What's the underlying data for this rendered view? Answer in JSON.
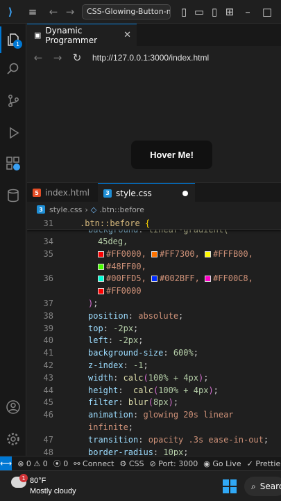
{
  "titlebar": {
    "command_center": "CSS-Glowing-Button-mast"
  },
  "browser": {
    "tab_title": "Dynamic Programmer",
    "url": "http://127.0.0.1:3000/index.html",
    "button_label": "Hover Me!"
  },
  "activity": {
    "explorer_badge": "1"
  },
  "editor": {
    "tabs": [
      {
        "label": "index.html",
        "icon": "html5-file-icon"
      },
      {
        "label": "style.css",
        "icon": "css3-file-icon",
        "dirty": true
      }
    ],
    "breadcrumb": {
      "file": "style.css",
      "symbol": ".btn::before"
    },
    "sticky": {
      "line": "31",
      "selector": ".btn::before",
      "brace": "{"
    },
    "partial_line": {
      "prop": "background",
      "val": "linear-gradient("
    },
    "lines": [
      {
        "n": "34",
        "parts": [
          {
            "t": "45deg,",
            "c": "num"
          }
        ]
      },
      {
        "n": "35",
        "parts": [
          {
            "sw": "#FF0000"
          },
          {
            "t": "#FF0000, ",
            "c": "val"
          },
          {
            "sw": "#FF7300"
          },
          {
            "t": "#FF7300, ",
            "c": "val"
          },
          {
            "sw": "#FFFB00"
          },
          {
            "t": "#FFFB00,",
            "c": "val"
          }
        ]
      },
      {
        "n": "",
        "parts": [
          {
            "sw": "#48FF00"
          },
          {
            "t": "#48FF00,",
            "c": "val"
          }
        ]
      },
      {
        "n": "36",
        "parts": [
          {
            "sw": "#00FFD5"
          },
          {
            "t": "#00FFD5, ",
            "c": "val"
          },
          {
            "sw": "#002BFF"
          },
          {
            "t": "#002BFF, ",
            "c": "val"
          },
          {
            "sw": "#FF00C8"
          },
          {
            "t": "#FF00C8,",
            "c": "val"
          }
        ]
      },
      {
        "n": "",
        "parts": [
          {
            "sw": "#FF0000"
          },
          {
            "t": "#FF0000",
            "c": "val"
          }
        ]
      },
      {
        "n": "37",
        "parts": [
          {
            "t": ")",
            "c": "paren"
          },
          {
            "t": ";",
            "c": "punc"
          }
        ]
      },
      {
        "n": "38",
        "parts": [
          {
            "t": "position",
            "c": "prop"
          },
          {
            "t": ": ",
            "c": "punc"
          },
          {
            "t": "absolute",
            "c": "val"
          },
          {
            "t": ";",
            "c": "punc"
          }
        ]
      },
      {
        "n": "39",
        "parts": [
          {
            "t": "top",
            "c": "prop"
          },
          {
            "t": ": ",
            "c": "punc"
          },
          {
            "t": "-2px",
            "c": "num"
          },
          {
            "t": ";",
            "c": "punc"
          }
        ]
      },
      {
        "n": "40",
        "parts": [
          {
            "t": "left",
            "c": "prop"
          },
          {
            "t": ": ",
            "c": "punc"
          },
          {
            "t": "-2px",
            "c": "num"
          },
          {
            "t": ";",
            "c": "punc"
          }
        ]
      },
      {
        "n": "41",
        "parts": [
          {
            "t": "background-size",
            "c": "prop"
          },
          {
            "t": ": ",
            "c": "punc"
          },
          {
            "t": "600%",
            "c": "num"
          },
          {
            "t": ";",
            "c": "punc"
          }
        ]
      },
      {
        "n": "42",
        "parts": [
          {
            "t": "z-index",
            "c": "prop"
          },
          {
            "t": ": ",
            "c": "punc"
          },
          {
            "t": "-1",
            "c": "num"
          },
          {
            "t": ";",
            "c": "punc"
          }
        ]
      },
      {
        "n": "43",
        "parts": [
          {
            "t": "width",
            "c": "prop"
          },
          {
            "t": ": ",
            "c": "punc"
          },
          {
            "t": "calc",
            "c": "fn"
          },
          {
            "t": "(",
            "c": "paren"
          },
          {
            "t": "100% + 4px",
            "c": "num"
          },
          {
            "t": ")",
            "c": "paren"
          },
          {
            "t": ";",
            "c": "punc"
          }
        ]
      },
      {
        "n": "44",
        "parts": [
          {
            "t": "height",
            "c": "prop"
          },
          {
            "t": ":  ",
            "c": "punc"
          },
          {
            "t": "calc",
            "c": "fn"
          },
          {
            "t": "(",
            "c": "paren"
          },
          {
            "t": "100% + 4px",
            "c": "num"
          },
          {
            "t": ")",
            "c": "paren"
          },
          {
            "t": ";",
            "c": "punc"
          }
        ]
      },
      {
        "n": "45",
        "parts": [
          {
            "t": "filter",
            "c": "prop"
          },
          {
            "t": ": ",
            "c": "punc"
          },
          {
            "t": "blur",
            "c": "fn"
          },
          {
            "t": "(",
            "c": "paren"
          },
          {
            "t": "8px",
            "c": "num"
          },
          {
            "t": ")",
            "c": "paren"
          },
          {
            "t": ";",
            "c": "punc"
          }
        ]
      },
      {
        "n": "46",
        "parts": [
          {
            "t": "animation",
            "c": "prop"
          },
          {
            "t": ": ",
            "c": "punc"
          },
          {
            "t": "glowing 20s linear",
            "c": "val"
          }
        ]
      },
      {
        "n": "",
        "parts": [
          {
            "t": "infinite",
            "c": "val"
          },
          {
            "t": ";",
            "c": "punc"
          }
        ]
      },
      {
        "n": "47",
        "parts": [
          {
            "t": "transition",
            "c": "prop"
          },
          {
            "t": ": ",
            "c": "punc"
          },
          {
            "t": "opacity .3s ease-in-out",
            "c": "val"
          },
          {
            "t": ";",
            "c": "punc"
          }
        ]
      },
      {
        "n": "48",
        "parts": [
          {
            "t": "border-radius",
            "c": "prop"
          },
          {
            "t": ": ",
            "c": "punc"
          },
          {
            "t": "10px",
            "c": "num"
          },
          {
            "t": ";",
            "c": "punc"
          }
        ]
      }
    ]
  },
  "statusbar": {
    "errors": "0",
    "warnings": "0",
    "ports": "0",
    "connect": "Connect",
    "language": "CSS",
    "port": "Port: 3000",
    "golive": "Go Live",
    "prettier": "Prettier"
  },
  "taskbar": {
    "temp": "80°F",
    "condition": "Mostly cloudy",
    "weather_badge": "1",
    "search": "Search"
  },
  "colors": {
    "accent": "#0078d4",
    "background": "#1f1f1f"
  }
}
